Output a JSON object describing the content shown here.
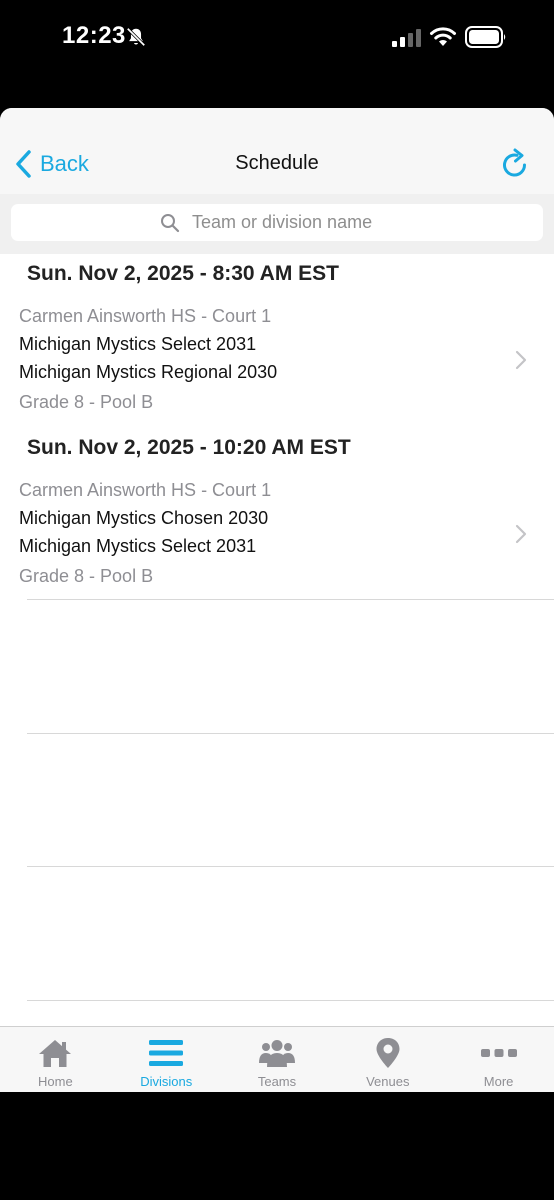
{
  "status_bar": {
    "time": "12:23"
  },
  "nav": {
    "back_label": "Back",
    "title": "Schedule"
  },
  "search": {
    "placeholder": "Team or division name"
  },
  "schedule": [
    {
      "header": "Sun. Nov 2, 2025 - 8:30 AM EST",
      "venue": "Carmen Ainsworth HS - Court 1",
      "team1": "Michigan Mystics Select 2031",
      "team2": "Michigan Mystics Regional 2030",
      "pool": "Grade 8 - Pool B"
    },
    {
      "header": "Sun. Nov 2, 2025 - 10:20 AM EST",
      "venue": "Carmen Ainsworth HS - Court 1",
      "team1": "Michigan Mystics Chosen 2030",
      "team2": "Michigan Mystics Select 2031",
      "pool": "Grade 8 - Pool B"
    }
  ],
  "tabs": [
    {
      "label": "Home",
      "icon": "home-icon"
    },
    {
      "label": "Divisions",
      "icon": "menu-icon",
      "active": true
    },
    {
      "label": "Teams",
      "icon": "people-icon"
    },
    {
      "label": "Venues",
      "icon": "map-pin-icon"
    },
    {
      "label": "More",
      "icon": "more-dots-icon"
    }
  ],
  "colors": {
    "accent": "#1aa9e0",
    "muted": "#8e8e93"
  }
}
